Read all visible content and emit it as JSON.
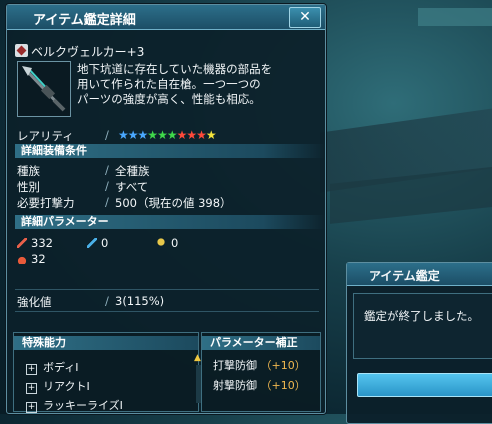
{
  "detail_window": {
    "title": "アイテム鑑定詳細",
    "close_symbol": "✕",
    "item_name": "ベルクヴェルカー+3",
    "description": "地下坑道に存在していた機器の部品を\n用いて作られた自在槍。一つ一つの\nパーツの強度が高く、性能も相応。",
    "rarity_label": "レアリティ",
    "rarity_stars": 9,
    "rarity_star_colors": [
      "#4aa8ff",
      "#4aa8ff",
      "#4aa8ff",
      "#3fd84a",
      "#3fd84a",
      "#3fd84a",
      "#ff4a3a",
      "#ff4a3a",
      "#ff4a3a",
      "#f4e43c"
    ],
    "req_section": "詳細装備条件",
    "race_label": "種族",
    "race_value": "全種族",
    "gender_label": "性別",
    "gender_value": "すべて",
    "req_atk_label": "必要打撃力",
    "req_atk_value": "500（現在の値 398）",
    "param_section": "詳細パラメーター",
    "params": {
      "striking_attack": "332",
      "ranged_attack": "0",
      "technique_attack": "0",
      "element": "32"
    },
    "param_icon_colors": {
      "striking": "#e8604a",
      "ranged": "#4ab0e8",
      "technique": "#e8c84a",
      "element": "#e85a3a"
    },
    "grind_label": "強化値",
    "grind_value": "3(115%)",
    "abilities_header": "特殊能力",
    "abilities": [
      "ボディⅠ",
      "リアクトⅠ",
      "ラッキーライズⅠ"
    ],
    "bonus_header": "パラメーター補正",
    "bonuses": [
      {
        "label": "打撃防御",
        "value": "（+10）"
      },
      {
        "label": "射撃防御",
        "value": "（+10）"
      }
    ]
  },
  "dialog": {
    "title": "アイテム鑑定",
    "message": "鑑定が終了しました。"
  }
}
